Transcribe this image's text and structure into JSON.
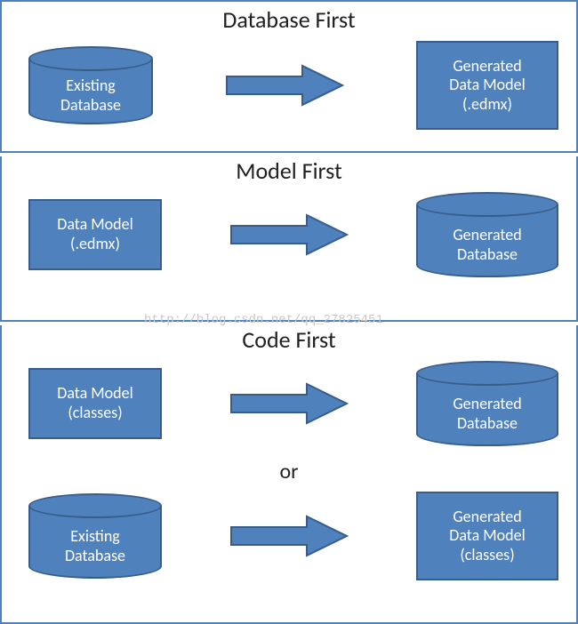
{
  "panels": {
    "databaseFirst": {
      "title": "Database First",
      "source": {
        "line1": "Existing",
        "line2": "Database"
      },
      "target": {
        "line1": "Generated",
        "line2": "Data Model",
        "line3": "(.edmx)"
      }
    },
    "modelFirst": {
      "title": "Model First",
      "source": {
        "line1": "Data Model",
        "line2": "(.edmx)"
      },
      "target": {
        "line1": "Generated",
        "line2": "Database"
      }
    },
    "codeFirst": {
      "title": "Code First",
      "connector": "or",
      "row1": {
        "source": {
          "line1": "Data Model",
          "line2": "(classes)"
        },
        "target": {
          "line1": "Generated",
          "line2": "Database"
        }
      },
      "row2": {
        "source": {
          "line1": "Existing",
          "line2": "Database"
        },
        "target": {
          "line1": "Generated",
          "line2": "Data Model",
          "line3": "(classes)"
        }
      }
    }
  },
  "watermark": "http://blog.csdn.net/qq_27825451",
  "colors": {
    "fill": "#4f81bd",
    "border": "#385d8a"
  }
}
